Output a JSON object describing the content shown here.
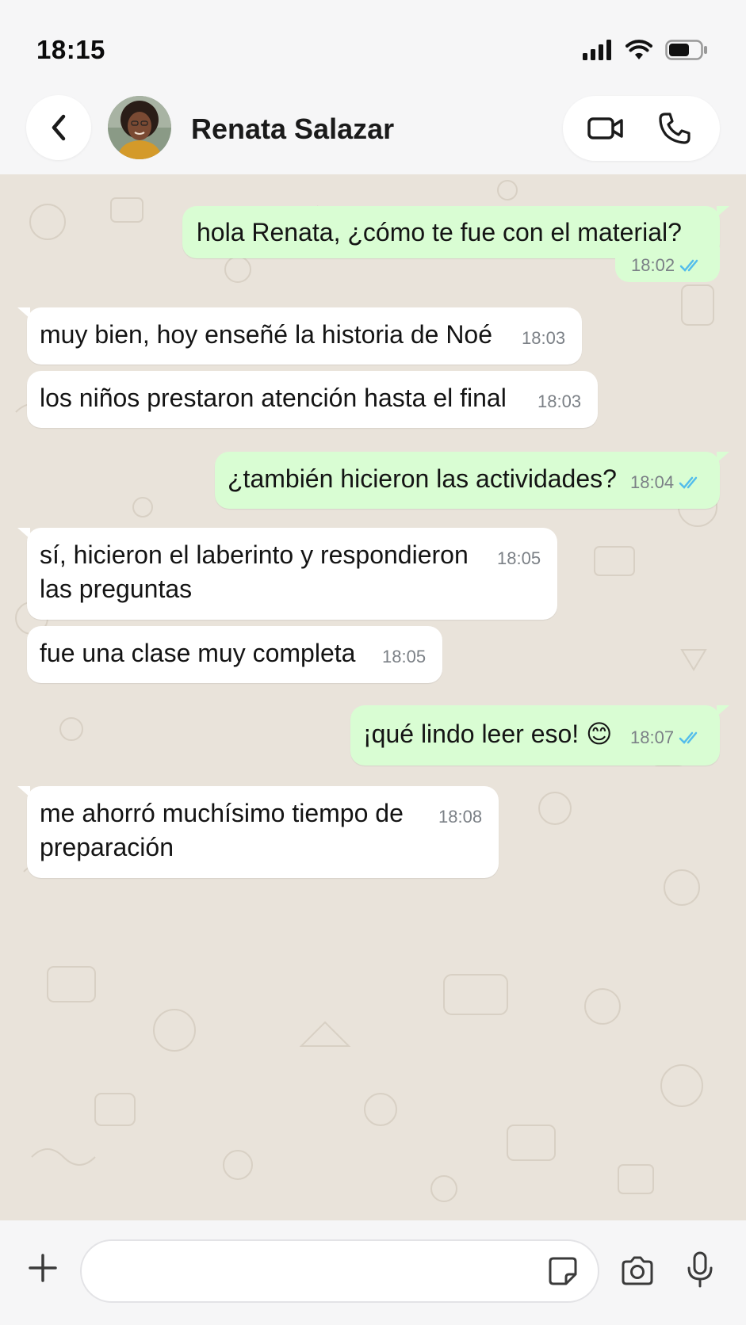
{
  "status_bar": {
    "time": "18:15"
  },
  "header": {
    "contact_name": "Renata Salazar"
  },
  "messages": [
    {
      "dir": "out",
      "text": "hola Renata, ¿cómo te fue con el material?",
      "time": "18:02",
      "read": true
    },
    {
      "dir": "in",
      "text": "muy bien, hoy enseñé la historia de Noé",
      "time": "18:03"
    },
    {
      "dir": "in",
      "text": "los niños prestaron atención hasta el final",
      "time": "18:03"
    },
    {
      "dir": "out",
      "text": "¿también hicieron las actividades?",
      "time": "18:04",
      "read": true
    },
    {
      "dir": "in",
      "line1": "sí, hicieron el laberinto y respondieron",
      "line2": "las preguntas",
      "time": "18:05"
    },
    {
      "dir": "in",
      "text": "fue una clase muy completa",
      "time": "18:05"
    },
    {
      "dir": "out",
      "text": "¡qué lindo leer eso! 😊",
      "time": "18:07",
      "read": true
    },
    {
      "dir": "in",
      "line1": "me ahorró muchísimo tiempo de",
      "line2": "preparación",
      "time": "18:08"
    }
  ],
  "composer": {
    "placeholder": ""
  },
  "colors": {
    "outgoing_bubble": "#d9fdd3",
    "incoming_bubble": "#ffffff",
    "read_ticks": "#53bdeb",
    "wallpaper": "#e9e3da"
  }
}
